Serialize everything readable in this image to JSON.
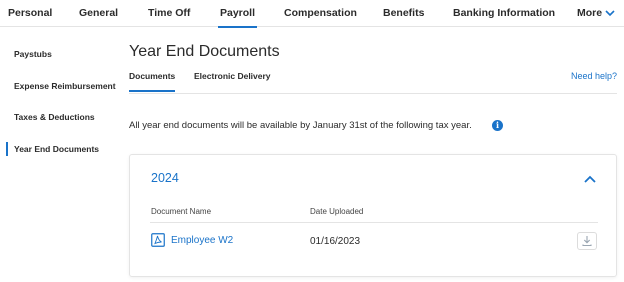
{
  "topnav": {
    "items": [
      {
        "label": "Personal"
      },
      {
        "label": "General"
      },
      {
        "label": "Time Off"
      },
      {
        "label": "Payroll"
      },
      {
        "label": "Compensation"
      },
      {
        "label": "Benefits"
      },
      {
        "label": "Banking Information"
      },
      {
        "label": "More"
      }
    ],
    "active": "Payroll"
  },
  "sidebar": {
    "items": [
      {
        "label": "Paystubs"
      },
      {
        "label": "Expense Reimbursement"
      },
      {
        "label": "Taxes & Deductions"
      },
      {
        "label": "Year End Documents"
      }
    ],
    "active": "Year End Documents"
  },
  "main": {
    "title": "Year End Documents",
    "tabs": [
      {
        "label": "Documents"
      },
      {
        "label": "Electronic Delivery"
      }
    ],
    "active_tab": "Documents",
    "help_link": "Need help?",
    "info_text": "All year end documents will be available by January 31st of the following tax year.",
    "info_icon_glyph": "i",
    "card": {
      "year": "2024",
      "columns": [
        "Document Name",
        "Date Uploaded"
      ],
      "rows": [
        {
          "name": "Employee W2",
          "date": "01/16/2023"
        }
      ]
    }
  },
  "colors": {
    "accent": "#1a73c9",
    "text": "#2b2b2b",
    "divider": "#e4e4e4"
  },
  "icons": [
    "chevron-down-icon",
    "info-icon",
    "chevron-up-icon",
    "pdf-icon",
    "download-icon"
  ]
}
